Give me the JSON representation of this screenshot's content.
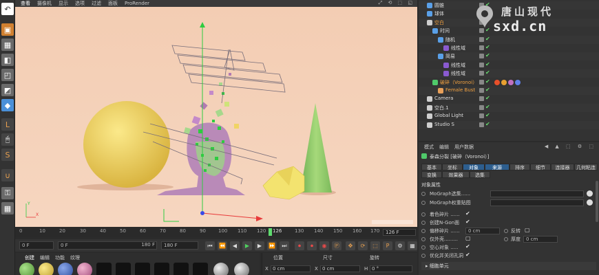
{
  "colors": {
    "viewport_bg": "#f3cdb3",
    "sphere": "#f0d465",
    "cone": "#8ec767",
    "rock": "#f3e36f",
    "timeline_marker": "#5fdc6f",
    "active_tab": "#2d5e8e",
    "fragment_green": "#2ecc40"
  },
  "viewport_menu": [
    "查看",
    "摄像机",
    "显示",
    "选项",
    "过滤",
    "面板",
    "ProRender"
  ],
  "viewport_icons": "⤢ ⟲ ⬚ ◱",
  "timeline": {
    "ticks": [
      "0",
      "10",
      "20",
      "30",
      "40",
      "50",
      "60",
      "70",
      "80",
      "90",
      "100",
      "110",
      "120",
      "130",
      "140",
      "150",
      "160",
      "170",
      "180"
    ],
    "current_marker": "126",
    "current_frame": "126 F",
    "start_field": "0 F",
    "min_field": "0 F",
    "max_field": "180 F",
    "end_field": "180 F"
  },
  "transport_buttons": [
    "⏮",
    "⏪",
    "◀",
    "▶",
    "▶",
    "⏩",
    "⏭",
    "⏺",
    "⏺",
    "◉",
    "Ⓟ",
    "✥",
    "⟳",
    "⬚",
    "P",
    "⚙",
    "▦"
  ],
  "material_tabs": [
    "创建",
    "编辑",
    "功能",
    "纹理"
  ],
  "coords": {
    "headers": [
      "位置",
      "尺寸",
      "旋转"
    ],
    "fields": [
      {
        "axis": "X",
        "value": "0 cm"
      },
      {
        "axis": "X",
        "value": "0 cm"
      },
      {
        "axis": "H",
        "value": "0 °"
      }
    ]
  },
  "objects": [
    {
      "name": "圆锥",
      "indent": 0,
      "icon_color": "#5aa0e8"
    },
    {
      "name": "球体",
      "indent": 0,
      "icon_color": "#5aa0e8"
    },
    {
      "name": "空白",
      "indent": 0,
      "icon_color": "#cfcfcf",
      "highlight": true
    },
    {
      "name": "时间",
      "indent": 1,
      "icon_color": "#5aa0e8"
    },
    {
      "name": "随机",
      "indent": 2,
      "icon_color": "#5aa0e8"
    },
    {
      "name": "线性域",
      "indent": 3,
      "icon_color": "#8a5ad0"
    },
    {
      "name": "简易",
      "indent": 2,
      "icon_color": "#5aa0e8"
    },
    {
      "name": "线性域",
      "indent": 3,
      "icon_color": "#8a5ad0"
    },
    {
      "name": "线性域",
      "indent": 3,
      "icon_color": "#8a5ad0"
    },
    {
      "name": "破碎（Voronoi）",
      "indent": 1,
      "icon_color": "#4fc96a",
      "highlight": true
    },
    {
      "name": "Female Bust",
      "indent": 2,
      "icon_color": "#e8a05a",
      "highlight": true
    },
    {
      "name": "Camera",
      "indent": 0,
      "icon_color": "#cfcfcf"
    },
    {
      "name": "空白.1",
      "indent": 0,
      "icon_color": "#cfcfcf"
    },
    {
      "name": "Global Light",
      "indent": 0,
      "icon_color": "#cfcfcf"
    },
    {
      "name": "Studio S",
      "indent": 0,
      "icon_color": "#cfcfcf"
    }
  ],
  "attributes": {
    "menu": [
      "模式",
      "编辑",
      "用户数据"
    ],
    "icons": "◀ ▲ ⬚ ⚙ ⬚",
    "title": "泰森分裂 [破碎（Voronoi）]",
    "tabs_row1": [
      "基本",
      "坐标",
      "对象",
      "来源",
      "排序",
      "细节",
      "连接器",
      "几何粘连"
    ],
    "tabs_row2": [
      "变换",
      "效果器",
      "选集"
    ],
    "section": "对象属性",
    "moGraph_selection_label": "MoGraph选集......",
    "moGraph_weight_label": "MoGraph权重贴图",
    "colorize_label": "着色碎片 ......",
    "ngon_label": "创建N-Gon面",
    "offset_label": "偏移碎片 ......",
    "offset_value": "0 cm",
    "invert_label": "反转",
    "outside_label": "仅外壳.........",
    "thickness_label": "厚度",
    "thickness_value": "0 cm",
    "hollow_label": "空心对象 .....",
    "optimize_label": "优化并关闭孔洞",
    "footer": "▸ 细胞单元"
  },
  "logo": {
    "chinese": "唐山现代",
    "english": "sxd.cn"
  }
}
